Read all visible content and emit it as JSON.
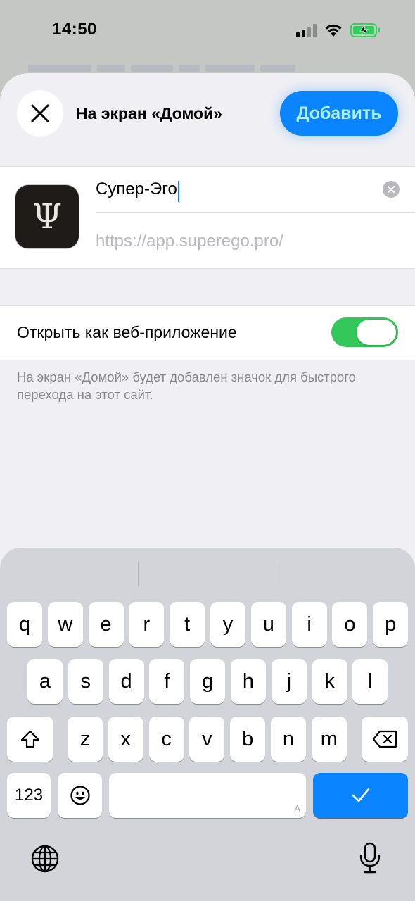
{
  "status_bar": {
    "time": "14:50",
    "battery_charging": true,
    "accent_colors": {
      "battery": "#30d158"
    }
  },
  "sheet": {
    "title": "На экран «Домой»",
    "close_icon": "close-x-icon",
    "add_button_label": "Добавить",
    "accent_color": "#0a84ff"
  },
  "app": {
    "icon_symbol": "Ψ",
    "name_value": "Супер-Эго",
    "url": "https://app.superego.pro/"
  },
  "web_app": {
    "label": "Открыть как веб-приложение",
    "enabled": true,
    "toggle_color": "#34c759"
  },
  "footnote": "На экран «Домой» будет добавлен значок для быстрого перехода на этот сайт.",
  "keyboard": {
    "row1": [
      "q",
      "w",
      "e",
      "r",
      "t",
      "y",
      "u",
      "i",
      "o",
      "p"
    ],
    "row2": [
      "a",
      "s",
      "d",
      "f",
      "g",
      "h",
      "j",
      "k",
      "l"
    ],
    "row3": [
      "z",
      "x",
      "c",
      "v",
      "b",
      "n",
      "m"
    ],
    "shift_icon": "shift-arrow-icon",
    "delete_icon": "delete-backspace-icon",
    "numbers_label": "123",
    "emoji_icon": "emoji-smiley-icon",
    "space_hint": "A",
    "done_icon": "checkmark-icon",
    "globe_icon": "globe-icon",
    "mic_icon": "microphone-icon"
  }
}
